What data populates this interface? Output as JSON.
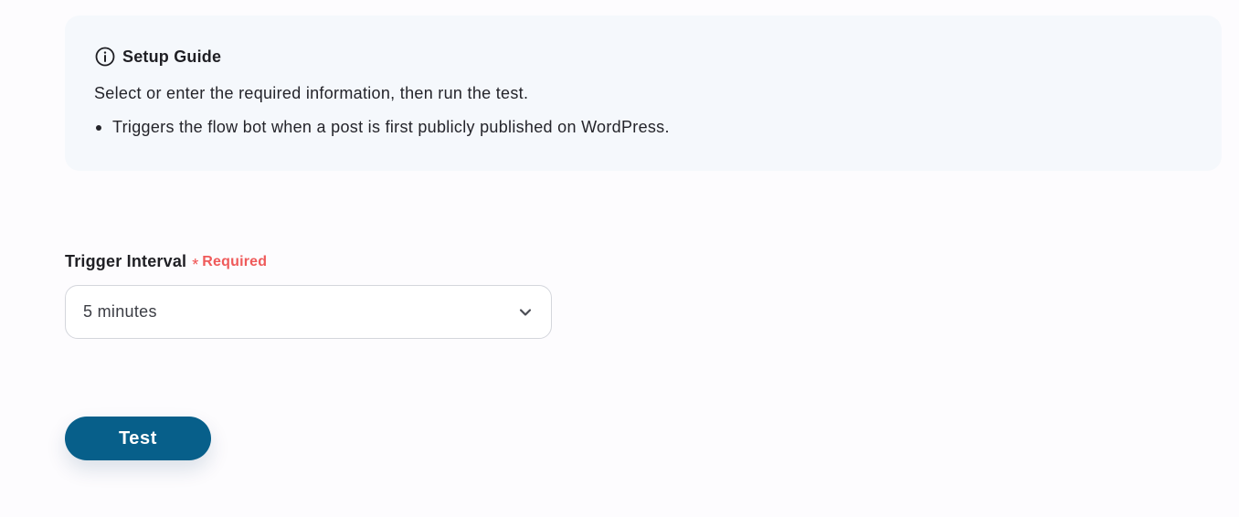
{
  "setup_guide": {
    "title": "Setup Guide",
    "icon": "info-icon",
    "description": "Select or enter the required information, then run the test.",
    "bullets": [
      "Triggers the flow bot when a post is first publicly published on WordPress."
    ]
  },
  "trigger_interval": {
    "label": "Trigger Interval",
    "required_marker": "*",
    "required_text": "Required",
    "selected_value": "5 minutes",
    "dropdown_icon": "chevron-down-icon"
  },
  "actions": {
    "test_label": "Test"
  },
  "colors": {
    "guide_background": "#f5f8fc",
    "required": "#ef5a5a",
    "primary_button": "#075f8a"
  }
}
